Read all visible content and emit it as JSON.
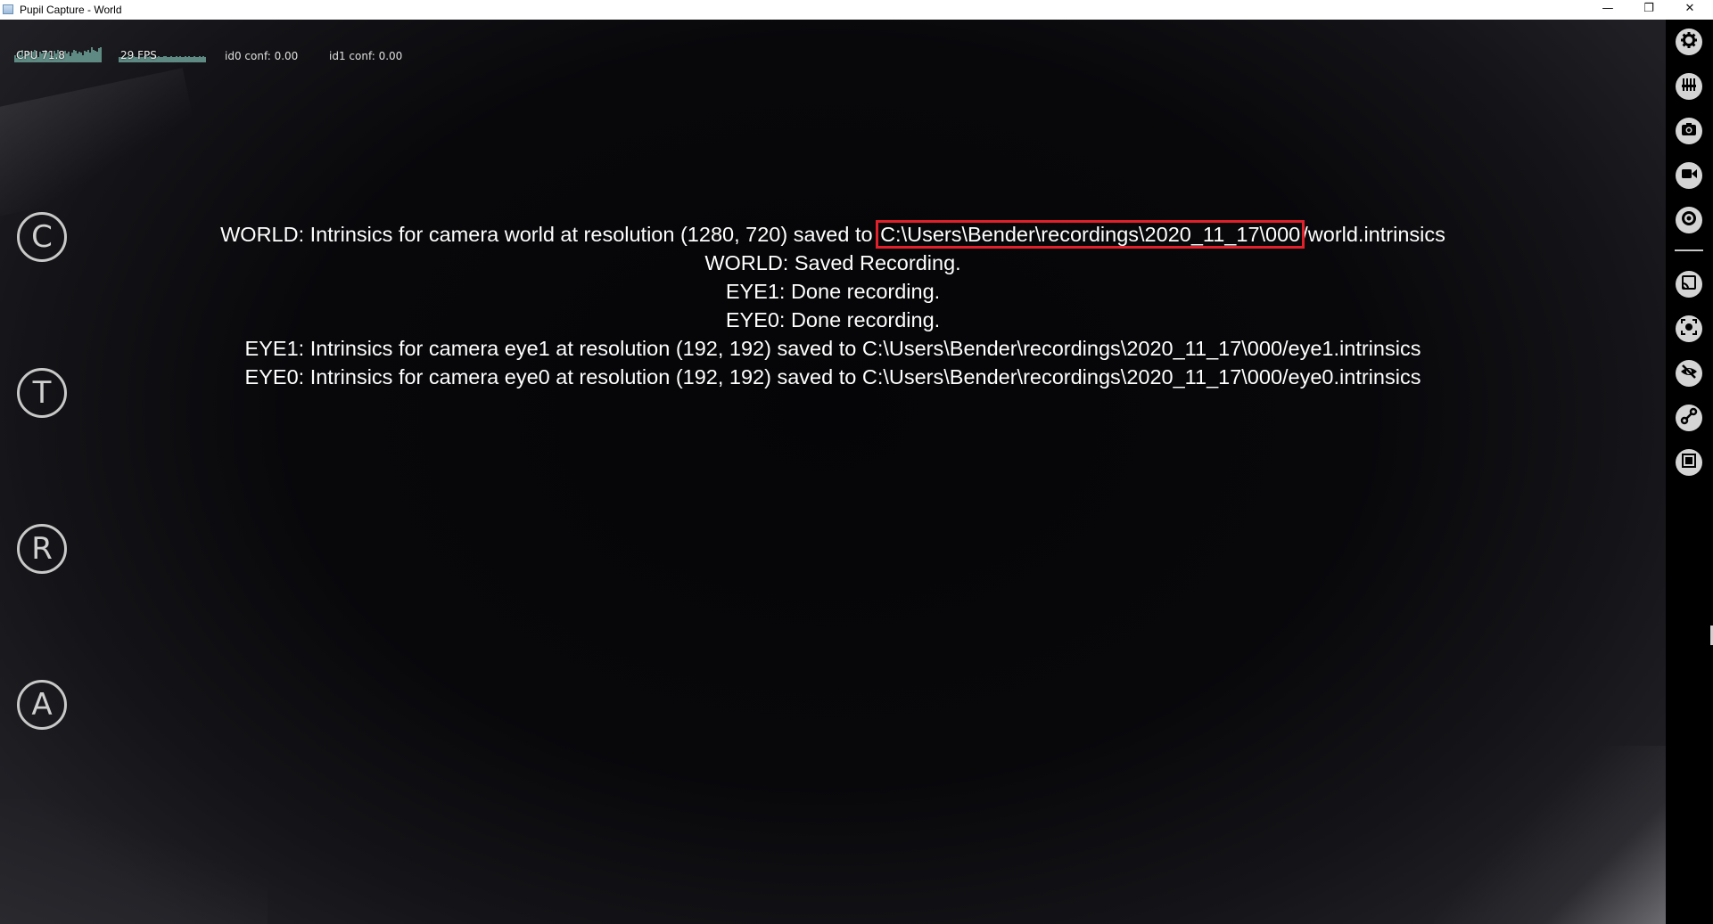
{
  "window": {
    "title": "Pupil Capture - World",
    "minimize_glyph": "—",
    "restore_glyph": "❐",
    "close_glyph": "✕"
  },
  "graphs": {
    "cpu_label": "CPU 71.8",
    "fps_label": "29 FPS",
    "cpu_history": [
      0.35,
      0.2,
      0.5,
      0.35,
      0.6,
      0.3,
      0.4,
      0.55,
      0.45,
      0.3,
      0.5,
      0.6,
      0.35,
      0.25,
      0.5,
      0.4,
      0.55,
      0.6,
      0.45,
      0.5,
      0.35,
      0.3,
      0.55,
      0.4,
      0.6,
      0.5,
      0.35,
      0.45,
      0.55,
      0.4,
      0.5,
      0.3,
      0.45,
      0.6,
      0.55,
      0.4,
      0.5,
      0.45,
      0.35,
      0.55,
      0.5,
      0.6,
      0.45,
      0.7,
      0.6,
      0.55,
      0.5,
      0.65,
      0.7
    ],
    "fps_history": [
      0.25,
      0.25,
      0.3,
      0.25,
      0.25,
      0.3,
      0.25,
      0.25,
      0.3,
      0.25,
      0.25,
      0.3,
      0.25,
      0.25,
      0.3,
      0.3,
      0.25,
      0.3,
      0.25,
      0.25,
      0.3,
      0.25,
      0.3,
      0.25,
      0.25,
      0.3,
      0.3,
      0.25,
      0.25,
      0.3,
      0.25,
      0.25,
      0.3,
      0.25,
      0.3,
      0.25,
      0.25,
      0.3,
      0.25,
      0.3,
      0.25,
      0.25,
      0.3,
      0.25,
      0.25,
      0.3,
      0.25,
      0.3,
      0.25
    ]
  },
  "confidence": {
    "id0": "id0 conf: 0.00",
    "id1": "id1 conf: 0.00"
  },
  "hotkeys": [
    {
      "letter": "C"
    },
    {
      "letter": "T"
    },
    {
      "letter": "R"
    },
    {
      "letter": "A"
    }
  ],
  "messages": {
    "line1_prefix": "WORLD: Intrinsics for camera world at resolution (1280, 720) saved to ",
    "line1_path": "C:\\Users\\Bender\\recordings\\2020_11_17\\000",
    "line1_suffix": "/world.intrinsics",
    "line2": "WORLD: Saved Recording.",
    "line3": "EYE1: Done recording.",
    "line4": "EYE0: Done recording.",
    "line5": "EYE1: Intrinsics for camera eye1 at resolution (192, 192) saved to C:\\Users\\Bender\\recordings\\2020_11_17\\000/eye1.intrinsics",
    "line6": "EYE0: Intrinsics for camera eye0 at resolution (192, 192) saved to C:\\Users\\Bender\\recordings\\2020_11_17\\000/eye0.intrinsics"
  },
  "sidebar": {
    "icons": [
      "gear-icon",
      "sliders-icon",
      "camera-icon",
      "video-camera-icon",
      "record-target-icon",
      "cast-icon",
      "focus-icon",
      "eye-off-icon",
      "link-icon",
      "frame-icon"
    ]
  },
  "colors": {
    "highlight_border": "#e0202a",
    "graph_fill": "#5f8a83",
    "icon_bg": "#d4d4d4"
  }
}
